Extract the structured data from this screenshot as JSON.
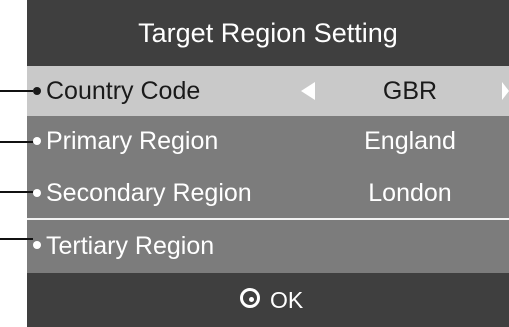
{
  "title": "Target Region Setting",
  "rows": [
    {
      "label": "Country Code",
      "value": "GBR"
    },
    {
      "label": "Primary Region",
      "value": "England"
    },
    {
      "label": "Secondary Region",
      "value": "London"
    },
    {
      "label": "Tertiary Region",
      "value": ""
    }
  ],
  "footer": {
    "ok_label": "OK",
    "ok_icon": "circle-dot-icon"
  },
  "colors": {
    "panel": "#3f3f3f",
    "selected_row": "#c9c9c9",
    "row": "#7c7c7c",
    "divider": "#f2f2f2",
    "text": "#ffffff"
  }
}
